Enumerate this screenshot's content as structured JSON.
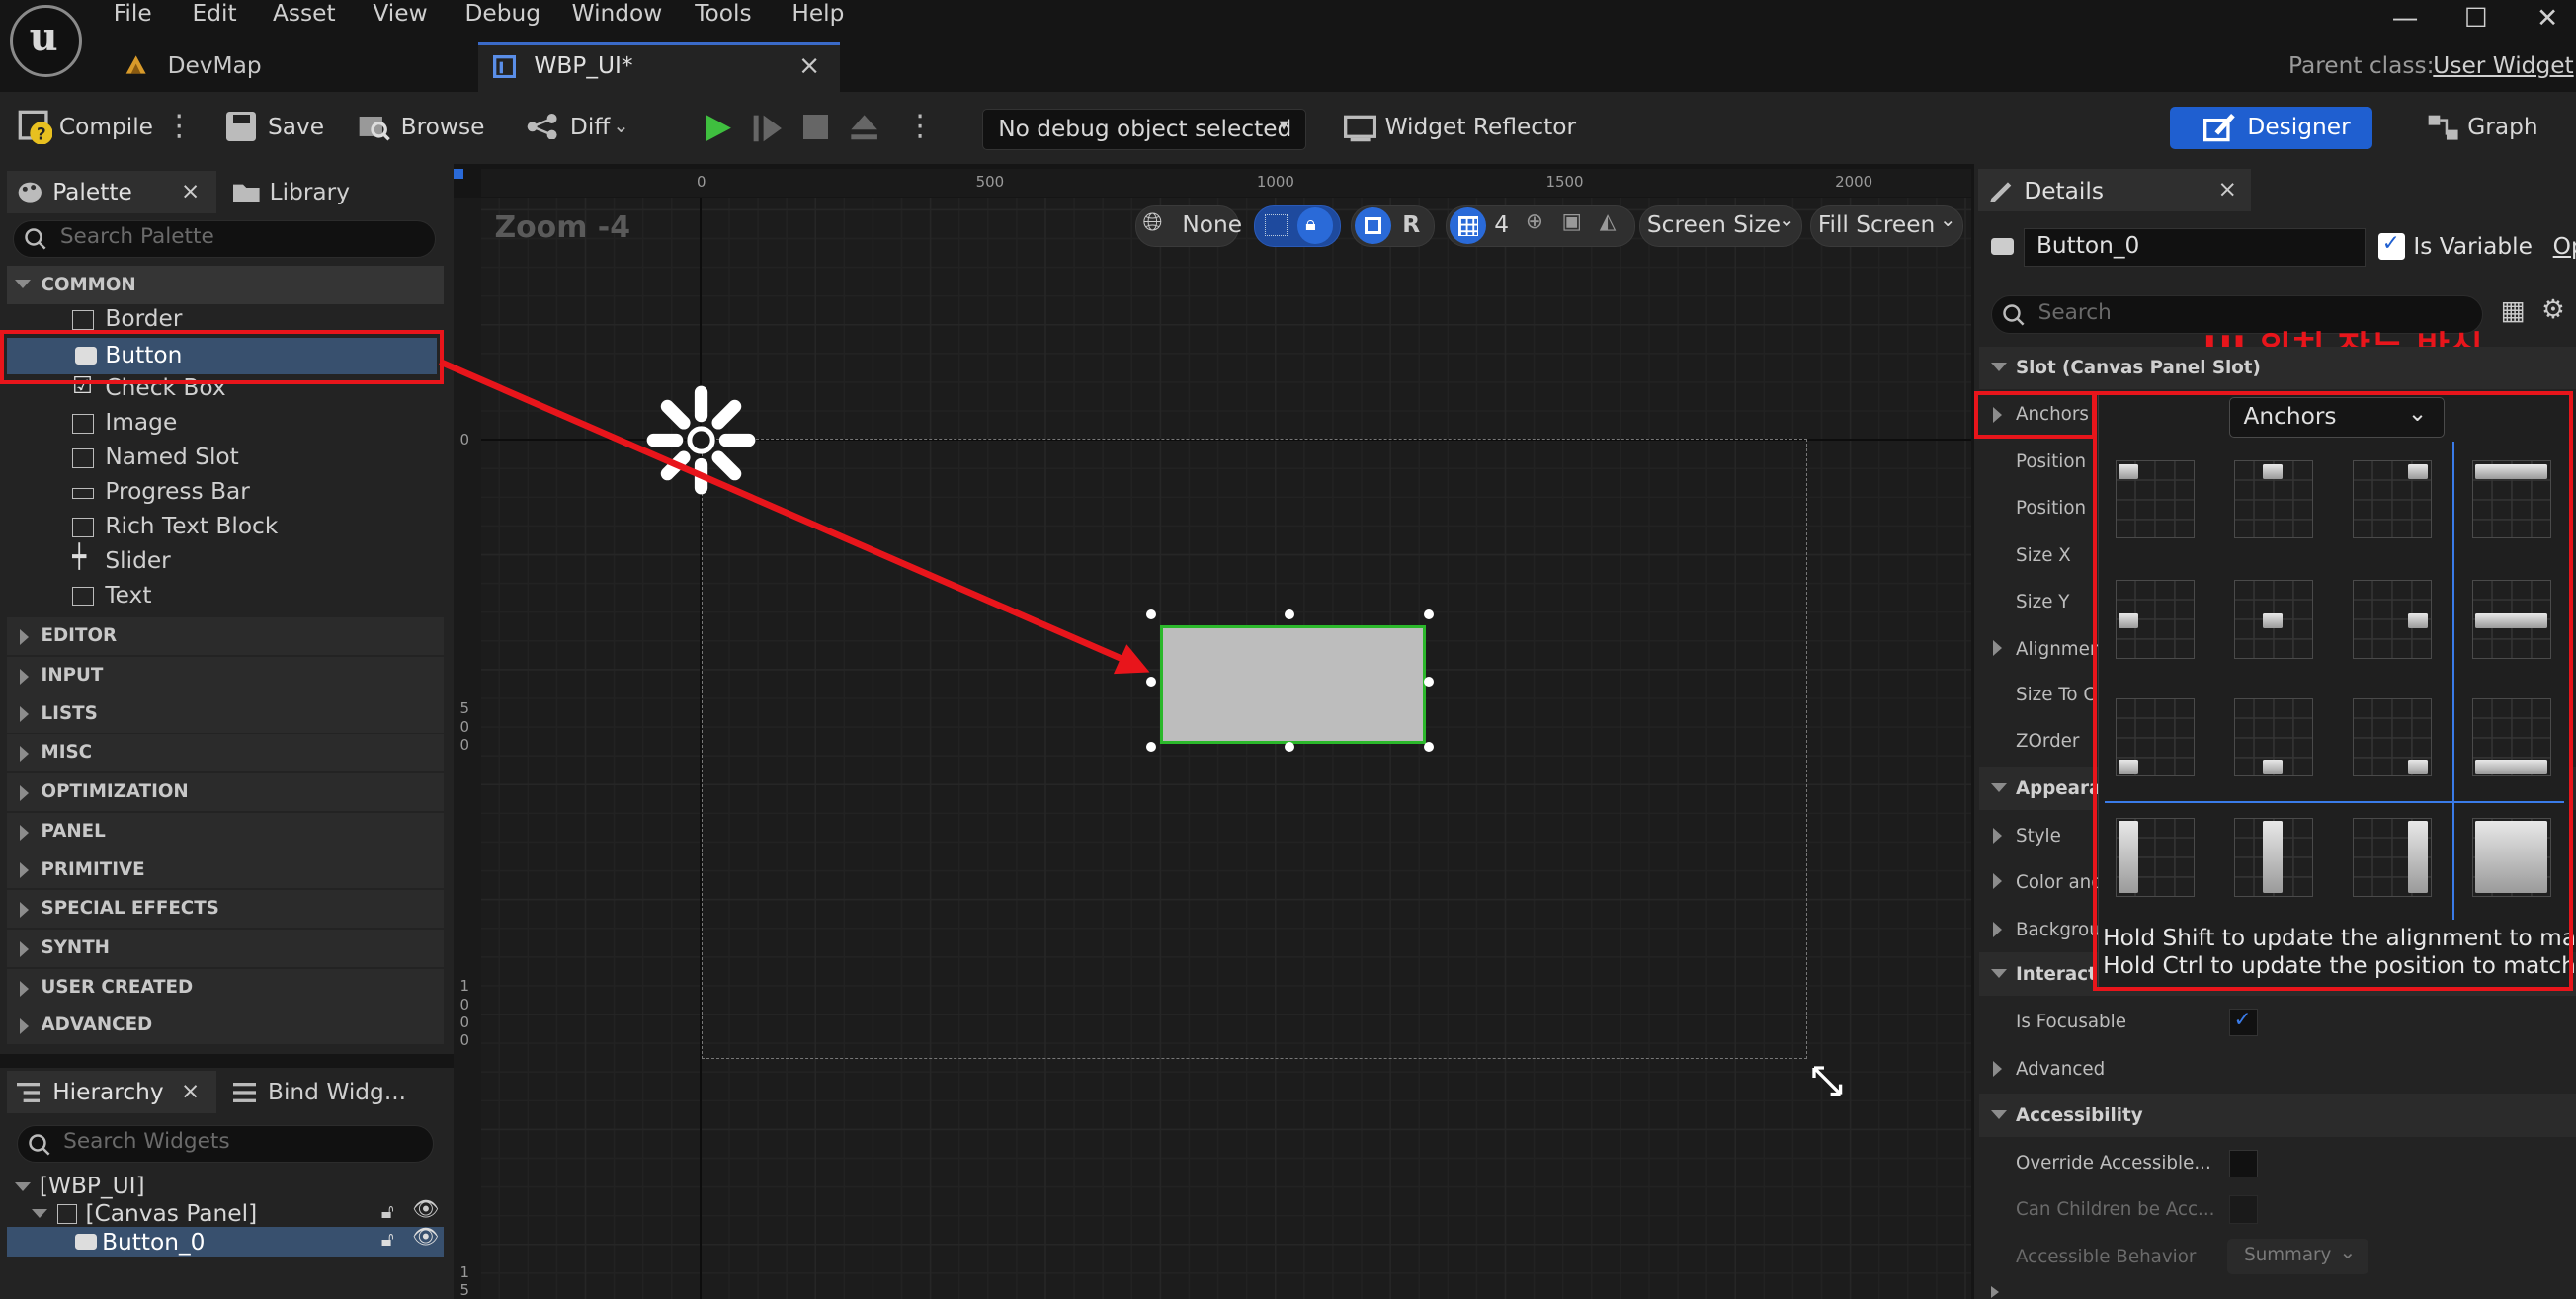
{
  "menu": [
    "File",
    "Edit",
    "Asset",
    "View",
    "Debug",
    "Window",
    "Tools",
    "Help"
  ],
  "tabs": [
    {
      "label": "DevMap"
    },
    {
      "label": "WBP_UI*",
      "close": "×"
    }
  ],
  "parent_class": {
    "label": "Parent class:",
    "value": "User Widget"
  },
  "window_controls": {
    "minimize": "—",
    "maximize": "☐",
    "close": "✕"
  },
  "toolbar": {
    "compile": "Compile",
    "save": "Save",
    "browse": "Browse",
    "diff": "Diff",
    "debug_object": "No debug object selected",
    "widget_reflector": "Widget Reflector",
    "designer": "Designer",
    "graph": "Graph"
  },
  "palette": {
    "tab": "Palette",
    "library_tab": "Library",
    "search_placeholder": "Search Palette",
    "category": "COMMON",
    "items": [
      "Border",
      "Button",
      "Check Box",
      "Image",
      "Named Slot",
      "Progress Bar",
      "Rich Text Block",
      "Slider",
      "Text"
    ],
    "categories": [
      "EDITOR",
      "INPUT",
      "LISTS",
      "MISC",
      "OPTIMIZATION",
      "PANEL",
      "PRIMITIVE",
      "SPECIAL EFFECTS",
      "SYNTH",
      "USER CREATED",
      "ADVANCED"
    ]
  },
  "hierarchy": {
    "tab": "Hierarchy",
    "bind_tab": "Bind Widg...",
    "search_placeholder": "Search Widgets",
    "items": [
      "[WBP_UI]",
      "[Canvas Panel]",
      "Button_0"
    ]
  },
  "viewport": {
    "zoom": "Zoom -4",
    "none": "None",
    "r": "R",
    "grid": "4",
    "screen_size": "Screen Size",
    "fill_screen": "Fill Screen",
    "ruler_top": [
      "0",
      "500",
      "1000",
      "1500",
      "2000"
    ],
    "ruler_left": [
      "0",
      "5\n0\n0",
      "1\n0\n0\n0",
      "1\n5"
    ]
  },
  "details": {
    "tab": "Details",
    "name": "Button_0",
    "is_variable": "Is Variable",
    "op": "Op",
    "search_placeholder": "Search",
    "annotation": "UI 위치 잡는 방식",
    "slot_section": "Slot (Canvas Panel Slot)",
    "anchors_label": "Anchors",
    "anchors_dropdown": "Anchors",
    "rows": [
      "Position",
      "Position",
      "Size X",
      "Size Y",
      "Alignmen",
      "Size To C",
      "ZOrder"
    ],
    "appearance": "Appearan",
    "style": "Style",
    "color": "Color and",
    "background": "Backgrou",
    "interaction": "Interacti",
    "is_focusable": "Is Focusable",
    "advanced": "Advanced",
    "accessibility": "Accessibility",
    "override": "Override Accessible...",
    "can_children": "Can Children be Acc...",
    "accessible_behavior": "Accessible Behavior",
    "summary": "Summary",
    "hint1": "Hold Shift to update the alignment to match.",
    "hint2": "Hold Ctrl to update the position to match."
  }
}
